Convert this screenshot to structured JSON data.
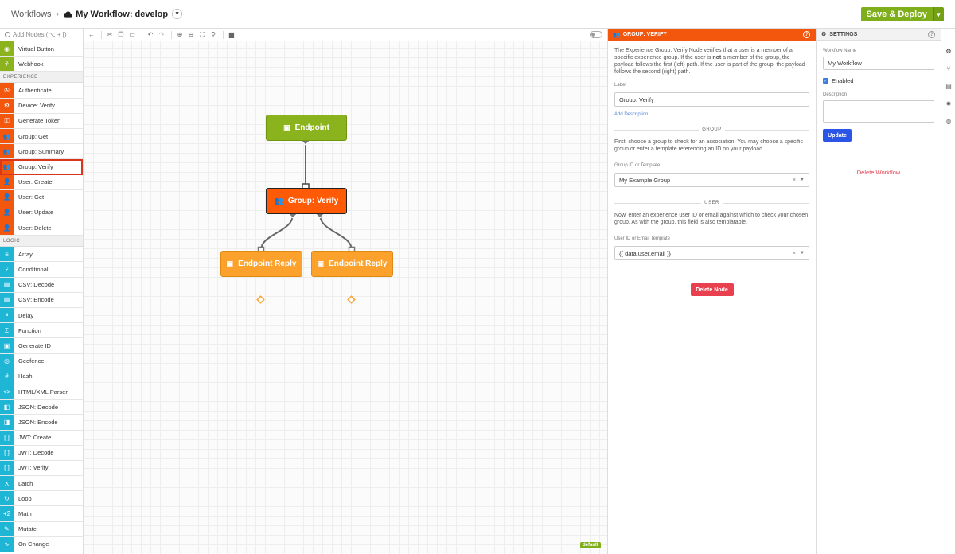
{
  "header": {
    "breadcrumb_root": "Workflows",
    "breadcrumb_sep": "›",
    "workflow_title": "My Workflow: develop",
    "deploy_label": "Save & Deploy"
  },
  "palette": {
    "search_placeholder": "Add Nodes (⌥ + [)",
    "top_items": [
      {
        "label": "Virtual Button",
        "icon": "◉",
        "color": "#8bb31d"
      },
      {
        "label": "Webhook",
        "icon": "⚘",
        "color": "#8bb31d"
      }
    ],
    "experience_title": "EXPERIENCE",
    "experience_items": [
      {
        "label": "Authenticate",
        "icon": "✇",
        "color": "#f2570d"
      },
      {
        "label": "Device: Verify",
        "icon": "⚙",
        "color": "#f2570d"
      },
      {
        "label": "Generate Token",
        "icon": "⚿",
        "color": "#f2570d"
      },
      {
        "label": "Group: Get",
        "icon": "👥",
        "color": "#f2570d"
      },
      {
        "label": "Group: Summary",
        "icon": "👥",
        "color": "#f2570d"
      },
      {
        "label": "Group: Verify",
        "icon": "👥",
        "color": "#f2570d"
      },
      {
        "label": "User: Create",
        "icon": "👤",
        "color": "#f2570d"
      },
      {
        "label": "User: Get",
        "icon": "👤",
        "color": "#f2570d"
      },
      {
        "label": "User: Update",
        "icon": "👤",
        "color": "#f2570d"
      },
      {
        "label": "User: Delete",
        "icon": "👤",
        "color": "#f2570d"
      }
    ],
    "logic_title": "LOGIC",
    "logic_items": [
      {
        "label": "Array",
        "icon": "≡",
        "color": "#1fb6d6"
      },
      {
        "label": "Conditional",
        "icon": "⑂",
        "color": "#1fb6d6"
      },
      {
        "label": "CSV: Decode",
        "icon": "▤",
        "color": "#1fb6d6"
      },
      {
        "label": "CSV: Encode",
        "icon": "▤",
        "color": "#1fb6d6"
      },
      {
        "label": "Delay",
        "icon": "⏸",
        "color": "#1fb6d6"
      },
      {
        "label": "Function",
        "icon": "Σ",
        "color": "#1fb6d6"
      },
      {
        "label": "Generate ID",
        "icon": "▣",
        "color": "#1fb6d6"
      },
      {
        "label": "Geofence",
        "icon": "◎",
        "color": "#1fb6d6"
      },
      {
        "label": "Hash",
        "icon": "#",
        "color": "#1fb6d6"
      },
      {
        "label": "HTML/XML Parser",
        "icon": "<>",
        "color": "#1fb6d6"
      },
      {
        "label": "JSON: Decode",
        "icon": "◧",
        "color": "#1fb6d6"
      },
      {
        "label": "JSON: Encode",
        "icon": "◨",
        "color": "#1fb6d6"
      },
      {
        "label": "JWT: Create",
        "icon": "[ ]",
        "color": "#1fb6d6"
      },
      {
        "label": "JWT: Decode",
        "icon": "[ ]",
        "color": "#1fb6d6"
      },
      {
        "label": "JWT: Verify",
        "icon": "[ ]",
        "color": "#1fb6d6"
      },
      {
        "label": "Latch",
        "icon": "⋏",
        "color": "#1fb6d6"
      },
      {
        "label": "Loop",
        "icon": "↻",
        "color": "#1fb6d6"
      },
      {
        "label": "Math",
        "icon": "+2",
        "color": "#1fb6d6"
      },
      {
        "label": "Mutate",
        "icon": "✎",
        "color": "#1fb6d6"
      },
      {
        "label": "On Change",
        "icon": "∿",
        "color": "#1fb6d6"
      }
    ]
  },
  "canvas": {
    "nodes": {
      "endpoint": "Endpoint",
      "group_verify": "Group: Verify",
      "reply_left": "Endpoint Reply",
      "reply_right": "Endpoint Reply"
    },
    "colors": {
      "endpoint": "#8bb31d",
      "group_verify": "#ff5a05",
      "reply": "#fca12b"
    },
    "badge": "default"
  },
  "node_panel": {
    "title": "GROUP: VERIFY",
    "description_1": "The Experience Group: Verify Node verifies that a user is a member of a specific experience group. If the user is ",
    "description_bold": "not",
    "description_2": " a member of the group, the payload follows the first (left) path. If the user is part of the group, the payload follows the second (right) path.",
    "label_caption": "Label",
    "label_value": "Group: Verify",
    "add_description": "Add Description",
    "group_section": "GROUP",
    "group_help": "First, choose a group to check for an association. You may choose a specific group or enter a template referencing an ID on your payload.",
    "group_field_caption": "Group ID or Template",
    "group_field_value": "My Example Group",
    "user_section": "USER",
    "user_help": "Now, enter an experience user ID or email against which to check your chosen group. As with the group, this field is also templatable.",
    "user_field_caption": "User ID or Email Template",
    "user_field_value": "{{ data.user.email }}",
    "delete_label": "Delete Node"
  },
  "settings": {
    "title": "SETTINGS",
    "name_caption": "Workflow Name",
    "name_value": "My Workflow",
    "enabled_label": "Enabled",
    "description_caption": "Description",
    "update_label": "Update",
    "delete_label": "Delete Workflow"
  }
}
